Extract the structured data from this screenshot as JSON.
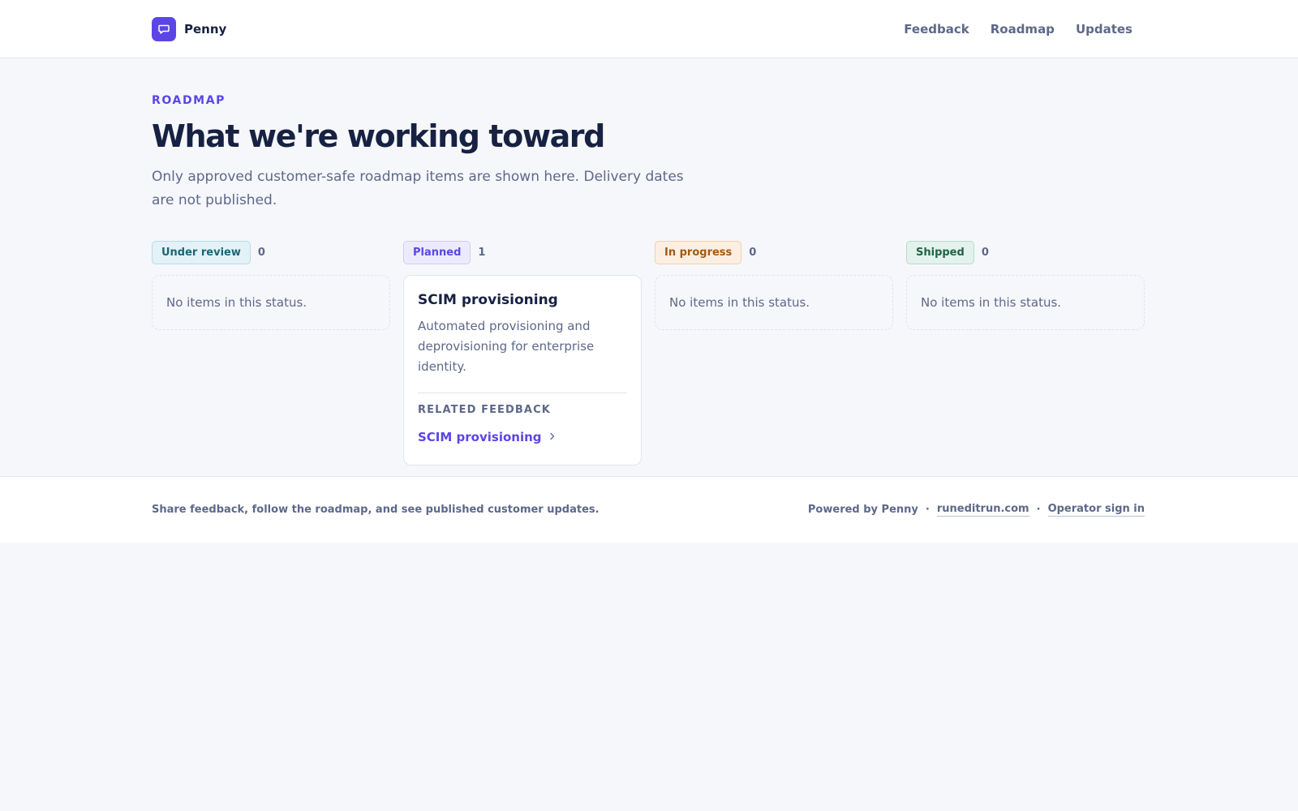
{
  "brand": {
    "name": "Penny",
    "icon": "chat-bubble-icon",
    "color": "#5b46e5"
  },
  "nav": {
    "feedback": "Feedback",
    "roadmap": "Roadmap",
    "updates": "Updates"
  },
  "hero": {
    "eyebrow": "ROADMAP",
    "title": "What we're working toward",
    "subtitle": "Only approved customer-safe roadmap items are shown here. Delivery dates are not published."
  },
  "columns": [
    {
      "status": "Under review",
      "count": "0",
      "empty_text": "No items in this status.",
      "color": "#1d6576"
    },
    {
      "status": "Planned",
      "count": "1",
      "color": "#5b46e5",
      "card": {
        "title": "SCIM provisioning",
        "description": "Automated provisioning and deprovisioning for enterprise identity.",
        "related_label": "RELATED FEEDBACK",
        "related_link": "SCIM provisioning"
      }
    },
    {
      "status": "In progress",
      "count": "0",
      "empty_text": "No items in this status.",
      "color": "#a35a12"
    },
    {
      "status": "Shipped",
      "count": "0",
      "empty_text": "No items in this status.",
      "color": "#206446"
    }
  ],
  "footer": {
    "tagline": "Share feedback, follow the roadmap, and see published customer updates.",
    "powered_by": "Powered by Penny",
    "separator": "·",
    "site_link": "runeditrun.com",
    "operator_link": "Operator sign in"
  }
}
